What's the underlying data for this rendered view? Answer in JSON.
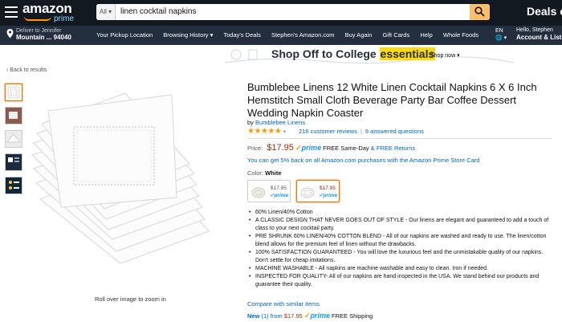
{
  "header": {
    "logo_text": "amazon",
    "logo_sub": "prime",
    "search_category": "All",
    "search_value": "linen cocktail napkins",
    "deals_text": "Deals o",
    "deliver_line1": "Deliver to Jennifer",
    "deliver_line2": "Mountain ... 94040",
    "nav_links": [
      "Your Pickup Location",
      "Browsing History ▾",
      "Today's Deals",
      "Stephen's Amazon.com",
      "Buy Again",
      "Gift Cards",
      "Help",
      "Whole Foods"
    ],
    "language": "EN",
    "language_icon": "globe-icon",
    "account_line1": "Hello, Stephen",
    "account_line2": "Account & Lists"
  },
  "banner": {
    "prefix": "Shop Off to College ",
    "highlight": "essentials",
    "shop_now": "Shop now ▾"
  },
  "back_link": "‹ Back to results",
  "gallery": {
    "thumb_count": 5,
    "rollover_text": "Roll over image to zoom in"
  },
  "product": {
    "title": "Bumblebee Linens 12 White Linen Cocktail Napkins 6 X 6 Inch Hemstitch Small Cloth Beverage Party Bar Coffee Dessert Wedding Napkin Coaster",
    "brand_prefix": "by ",
    "brand": "Bumblebee Linens",
    "stars": "★★★★★",
    "rating_dropdown": "▾",
    "reviews": "216 customer reviews",
    "answered": "9 answered questions",
    "price_label": "Price:",
    "price": "$17.95",
    "prime_check": "✓",
    "prime": "prime",
    "same_day": "FREE Same-Day",
    "free_returns_prefix": "& ",
    "free_returns": "FREE Returns",
    "promo": "You can get 5% back on all Amazon.com purchases with the Amazon Prime Store Card",
    "color_label": "Color: ",
    "color_value": "White",
    "swatches": [
      {
        "price": "$17.95",
        "prime": "✓prime"
      },
      {
        "price": "$17.95",
        "prime": "✓prime"
      }
    ],
    "bullets": [
      "60% Linen/40% Cotton",
      "A CLASSIC DESIGN THAT NEVER GOES OUT OF STYLE - Our linens are elegant and guaranteed to add a touch of class to your next cocktail party.",
      "PRE SHRUNK 60% LINEN/40% COTTON BLEND - All of our napkins are washed and ready to use. The linen/cotton blend allows for the premium feel of linen without the drawbacks.",
      "100% SATISFACTION GUARANTEED - You will love the luxurious feel and the unmistakable quality of our napkins. Don't settle for cheap imitations.",
      "MACHINE WASHABLE - All napkins are machine washable and easy to clean. Iron if needed.",
      "INSPECTED FOR QUALITY- All of our napkins are hand inspected in the USA. We stand behind our products and guarantee their quality."
    ],
    "compare": "Compare with similar items",
    "new_label": "New",
    "new_from": " (1) from ",
    "new_price": "$17.95",
    "new_shipping": "FREE Shipping"
  }
}
